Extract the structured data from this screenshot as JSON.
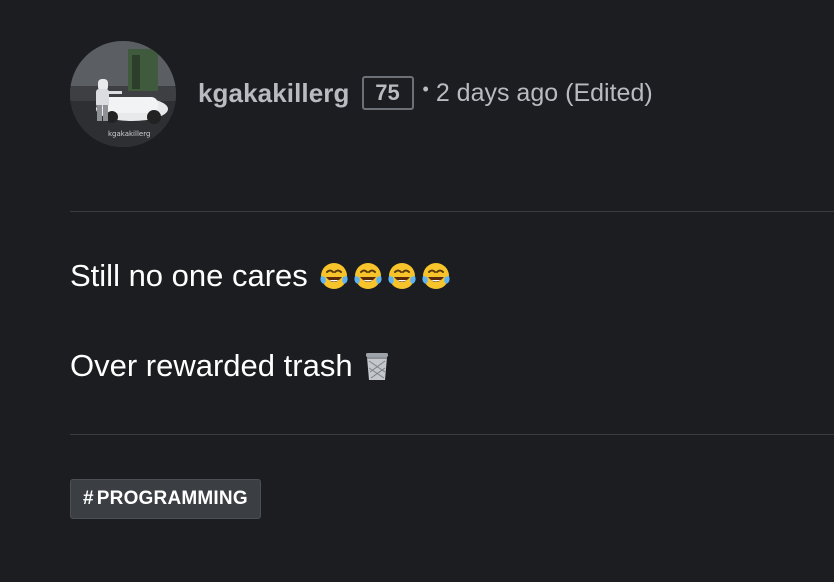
{
  "post": {
    "author": {
      "username": "kgakakillerg",
      "reputation": "75",
      "avatar_icon": "avatar-photo"
    },
    "separator": "•",
    "time_ago": "2 days ago",
    "edited_label": "(Edited)",
    "lines": [
      {
        "text": "Still no one cares",
        "emoji": [
          "face-with-tears-of-joy",
          "face-with-tears-of-joy",
          "face-with-tears-of-joy",
          "face-with-tears-of-joy"
        ]
      },
      {
        "text": "Over rewarded trash",
        "emoji": [
          "wastebasket"
        ]
      }
    ],
    "tag": {
      "hash": "#",
      "label": "PROGRAMMING"
    }
  },
  "colors": {
    "background": "#1c1d21",
    "meta_text": "#b8bbc0",
    "body_text": "#ffffff",
    "divider": "#3a3c41",
    "tag_bg": "#3b3e43"
  }
}
